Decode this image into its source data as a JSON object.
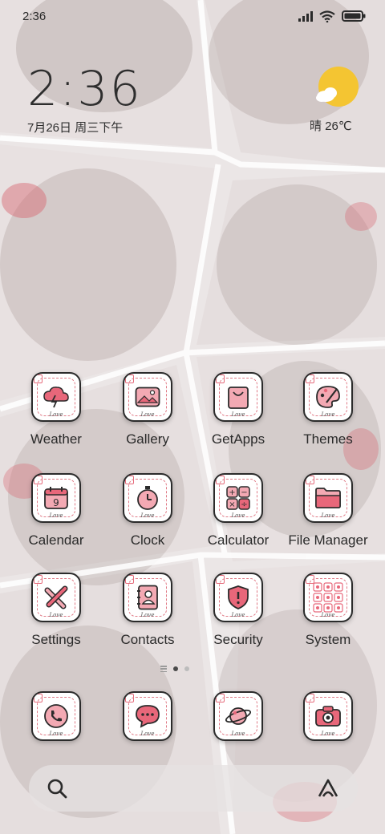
{
  "status_bar": {
    "time": "2:36"
  },
  "clock_widget": {
    "time": "2:36",
    "date": "7月26日 周三下午"
  },
  "weather_widget": {
    "temp": "晴 26℃",
    "icon": "sun-cloud-icon"
  },
  "apps_row1": [
    {
      "label": "Weather",
      "icon": "weather-icon"
    },
    {
      "label": "Gallery",
      "icon": "gallery-icon"
    },
    {
      "label": "GetApps",
      "icon": "shopping-bag-icon"
    },
    {
      "label": "Themes",
      "icon": "palette-icon"
    }
  ],
  "apps_row2": [
    {
      "label": "Calendar",
      "icon": "calendar-icon"
    },
    {
      "label": "Clock",
      "icon": "stopwatch-icon"
    },
    {
      "label": "Calculator",
      "icon": "calculator-icon"
    },
    {
      "label": "File Manager",
      "icon": "folder-icon"
    }
  ],
  "apps_row3": [
    {
      "label": "Settings",
      "icon": "tools-icon"
    },
    {
      "label": "Contacts",
      "icon": "contacts-book-icon"
    },
    {
      "label": "Security",
      "icon": "shield-icon"
    },
    {
      "label": "System",
      "icon": "folder-grid-icon"
    }
  ],
  "dock": [
    {
      "name": "phone",
      "icon": "phone-icon"
    },
    {
      "name": "messages",
      "icon": "chat-bubble-icon"
    },
    {
      "name": "browser",
      "icon": "planet-icon"
    },
    {
      "name": "camera",
      "icon": "camera-icon"
    }
  ],
  "icon_badge_text": "Love",
  "colors": {
    "accent": "#e8677a",
    "icon_border": "#2b2b2b"
  }
}
